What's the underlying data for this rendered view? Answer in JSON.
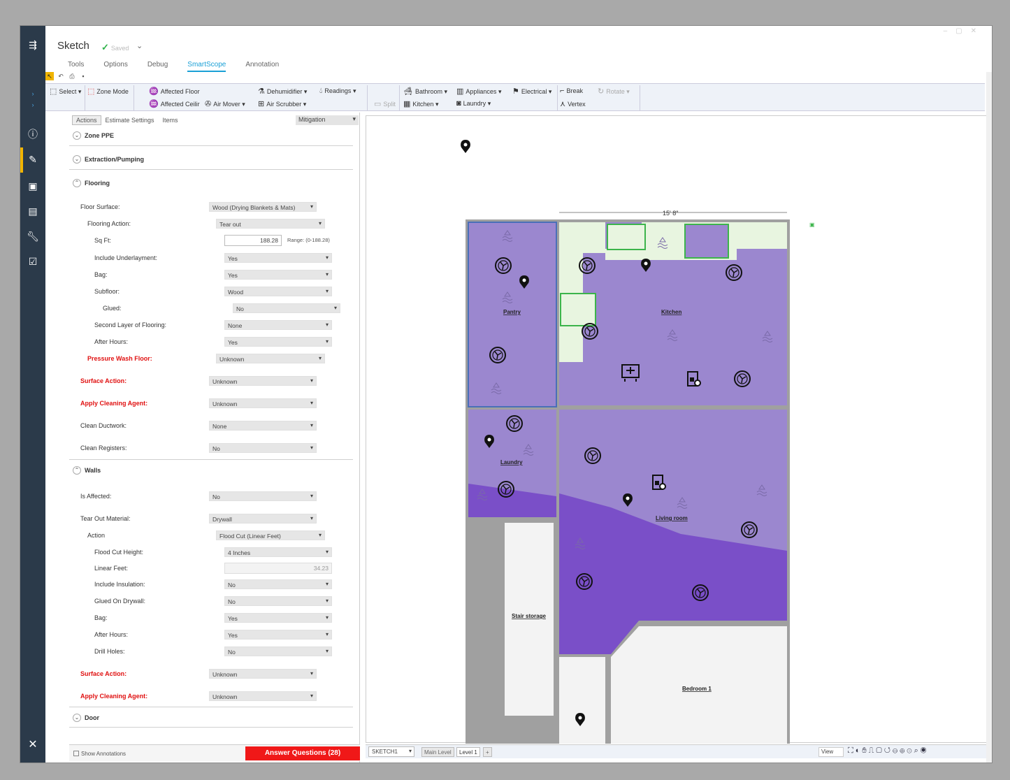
{
  "app": {
    "title": "Sketch",
    "saved_label": "Saved",
    "menu_tabs": [
      "Tools",
      "Options",
      "Debug",
      "SmartScope",
      "Annotation"
    ],
    "active_tab": "SmartScope"
  },
  "toolbar": {
    "select": "Select",
    "zone_mode": "Zone Mode",
    "affected_floor": "Affected Floor",
    "affected_ceiling": "Affected Ceilir",
    "air_mover": "Air Mover",
    "dehumidifier": "Dehumidifier",
    "air_scrubber": "Air Scrubber",
    "readings": "Readings",
    "split": "Split",
    "bathroom": "Bathroom",
    "kitchen": "Kitchen",
    "appliances": "Appliances",
    "laundry": "Laundry",
    "electrical": "Electrical",
    "break": "Break",
    "vertex": "Vertex",
    "rotate": "Rotate"
  },
  "panel": {
    "tabs": [
      "Actions",
      "Estimate Settings",
      "Items"
    ],
    "active_tab": "Actions",
    "mode_select": "Mitigation",
    "sections": {
      "zone_ppe": "Zone PPE",
      "extraction": "Extraction/Pumping",
      "flooring": "Flooring",
      "walls": "Walls",
      "door": "Door"
    },
    "flooring_rows": [
      {
        "label": "Floor Surface:",
        "value": "Wood (Drying Blankets & Mats)"
      },
      {
        "label": "Flooring Action:",
        "value": "Tear out"
      },
      {
        "label": "Sq Ft:",
        "value": "188.28",
        "range": "Range: (0-188.28)"
      },
      {
        "label": "Include Underlayment:",
        "value": "Yes"
      },
      {
        "label": "Bag:",
        "value": "Yes"
      },
      {
        "label": "Subfloor:",
        "value": "Wood"
      },
      {
        "label": "Glued:",
        "value": "No"
      },
      {
        "label": "Second Layer of Flooring:",
        "value": "None"
      },
      {
        "label": "After Hours:",
        "value": "Yes"
      },
      {
        "label": "Pressure Wash Floor:",
        "value": "Unknown"
      },
      {
        "label": "Surface Action:",
        "value": "Unknown"
      },
      {
        "label": "Apply Cleaning Agent:",
        "value": "Unknown"
      },
      {
        "label": "Clean Ductwork:",
        "value": "None"
      },
      {
        "label": "Clean Registers:",
        "value": "No"
      }
    ],
    "walls_rows": [
      {
        "label": "Is Affected:",
        "value": "No"
      },
      {
        "label": "Tear Out Material:",
        "value": "Drywall"
      },
      {
        "label": "Action",
        "value": "Flood Cut (Linear Feet)"
      },
      {
        "label": "Flood Cut Height:",
        "value": "4 Inches"
      },
      {
        "label": "Linear Feet:",
        "value": "34.23"
      },
      {
        "label": "Include Insulation:",
        "value": "No"
      },
      {
        "label": "Glued On Drywall:",
        "value": "No"
      },
      {
        "label": "Bag:",
        "value": "Yes"
      },
      {
        "label": "After Hours:",
        "value": "Yes"
      },
      {
        "label": "Drill Holes:",
        "value": "No"
      },
      {
        "label": "Surface Action:",
        "value": "Unknown"
      },
      {
        "label": "Apply Cleaning Agent:",
        "value": "Unknown"
      }
    ],
    "show_annotations": "Show Annotations",
    "answer_button": "Answer Questions (28)"
  },
  "sketch": {
    "dimension_label": "15' 8\"",
    "rooms": {
      "pantry": "Pantry",
      "kitchen": "Kitchen",
      "laundry": "Laundry",
      "living_room": "Living room",
      "stair_storage": "Stair storage",
      "bedroom": "Bedroom 1"
    },
    "colors": {
      "room_fill": "#9b87cf",
      "room_fill_dark": "#7a4fc8",
      "wall": "#a0a0a0",
      "cabinet": "#e8f5e0"
    }
  },
  "statusbar": {
    "sheet": "SKETCH1",
    "levels": [
      "Main Level",
      "Level 1"
    ],
    "active_level": "Level 1",
    "view_label": "View"
  }
}
